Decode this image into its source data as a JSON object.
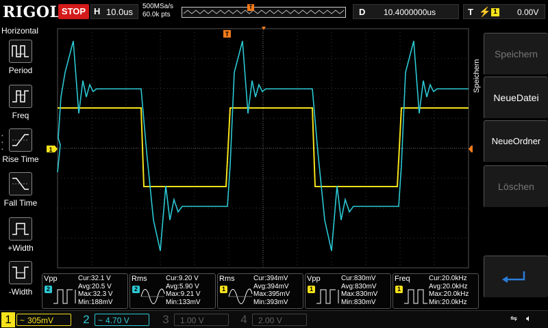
{
  "brand": {
    "logo": "RIGOL"
  },
  "run_state": {
    "label": "STOP"
  },
  "horizontal": {
    "letter": "H",
    "timebase": "10.0us",
    "sample_rate": "500MSa/s",
    "points": "60.0k pts"
  },
  "delay": {
    "letter": "D",
    "value": "10.4000000us"
  },
  "trigger": {
    "letter": "T",
    "edge": "rising",
    "channel": "1",
    "level": "0.00V"
  },
  "left_panel": {
    "title": "Horizontal",
    "items": [
      {
        "label": "Period",
        "icon": "period-icon"
      },
      {
        "label": "Freq",
        "icon": "freq-icon"
      },
      {
        "label": "Rise Time",
        "icon": "rise-time-icon"
      },
      {
        "label": "Fall Time",
        "icon": "fall-time-icon"
      },
      {
        "label": "+Width",
        "icon": "pos-width-icon"
      },
      {
        "label": "-Width",
        "icon": "neg-width-icon"
      }
    ]
  },
  "right_menu": {
    "title": "Speichern",
    "buttons": [
      {
        "label": "Speichern",
        "enabled": false
      },
      {
        "label": "NeueDatei",
        "enabled": true
      },
      {
        "label": "NeueOrdner",
        "enabled": true
      },
      {
        "label": "Löschen",
        "enabled": false
      },
      {
        "label": "↵",
        "enabled": true,
        "icon": "return-icon"
      }
    ]
  },
  "markers": {
    "ch1_level": "1",
    "trigger_pos": "T",
    "trigger_level": "T"
  },
  "measurements": [
    {
      "name": "Vpp",
      "channel": "2",
      "channel_color": "#2cc9d4",
      "icon": "vpp-icon",
      "rows": [
        "Cur:32.1 V",
        "Avg:20.5 V",
        "Max:32.3 V",
        "Min:188mV"
      ]
    },
    {
      "name": "Rms",
      "channel": "2",
      "channel_color": "#2cc9d4",
      "icon": "rms-icon",
      "rows": [
        "Cur:9.20 V",
        "Avg:5.90 V",
        "Max:9.21 V",
        "Min:133mV"
      ]
    },
    {
      "name": "Rms",
      "channel": "1",
      "channel_color": "#f5e21b",
      "icon": "rms-icon",
      "rows": [
        "Cur:394mV",
        "Avg:394mV",
        "Max:395mV",
        "Min:393mV"
      ]
    },
    {
      "name": "Vpp",
      "channel": "1",
      "channel_color": "#f5e21b",
      "icon": "vpp-icon",
      "rows": [
        "Cur:830mV",
        "Avg:830mV",
        "Max:830mV",
        "Min:830mV"
      ]
    },
    {
      "name": "Freq",
      "channel": "1",
      "channel_color": "#f5e21b",
      "icon": "freq-icon",
      "rows": [
        "Cur:20.0kHz",
        "Avg:20.0kHz",
        "Max:20.0kHz",
        "Min:20.0kHz"
      ]
    }
  ],
  "channels": [
    {
      "num": "1",
      "value": "305mV",
      "coupling": "~",
      "color": "#f5e21b",
      "active": true
    },
    {
      "num": "2",
      "value": "4.70 V",
      "coupling": "~",
      "color": "#2cc9d4",
      "active": true
    },
    {
      "num": "3",
      "value": "1.00 V",
      "coupling": "",
      "color": "#d72cd4",
      "active": false
    },
    {
      "num": "4",
      "value": "2.00 V",
      "coupling": "",
      "color": "#3c6cd4",
      "active": false
    }
  ],
  "colors": {
    "ch1": "#f5e21b",
    "ch2": "#2cc9d4",
    "grid": "#4a4a4a",
    "trigger": "#f47a1a"
  }
}
